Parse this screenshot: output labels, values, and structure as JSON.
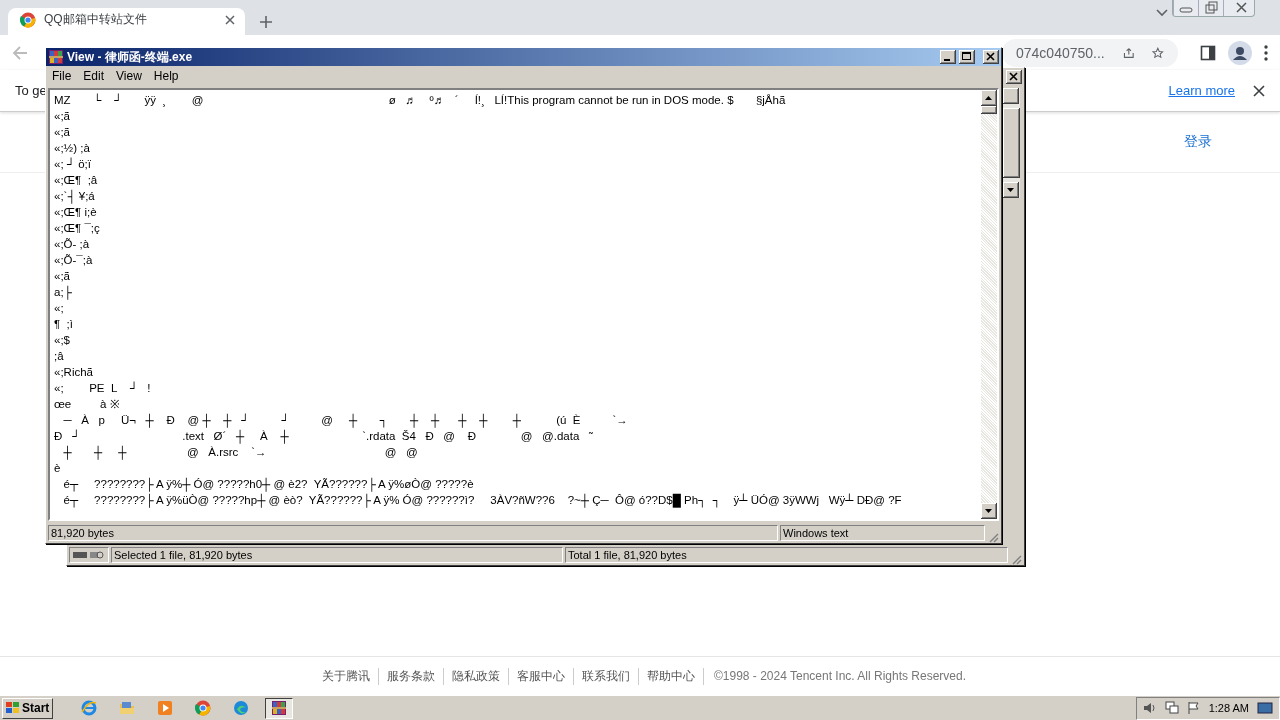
{
  "browser": {
    "tab": {
      "title": "QQ邮箱中转站文件"
    },
    "address": "074c040750...",
    "infobar": {
      "message": "To ge",
      "link": "Learn more"
    },
    "page": {
      "login": "登录",
      "footer_links": [
        "关于腾讯",
        "服务条款",
        "隐私政策",
        "客服中心",
        "联系我们",
        "帮助中心"
      ],
      "copyright": "©1998 - 2024 Tencent Inc. All Rights Reserved."
    }
  },
  "archiver_window": {
    "status_left": "Selected 1 file, 81,920 bytes",
    "status_right": "Total 1 file, 81,920 bytes"
  },
  "viewer_window": {
    "title": "View - 律师函-终端.exe",
    "menu": [
      "File",
      "Edit",
      "View",
      "Help"
    ],
    "lines": [
      "MZ       └    ┘       ÿÿ  ¸        @                                                          ø   ♬    º♬   ´     Í!¸   LÍ!This program cannot be run in DOS mode. $       §jÅhã",
      "«;ã",
      "«;ã",
      "«;½) ;à",
      "«; ┘ ö;ï",
      "«;Œ¶  ;â",
      "«;`┤ ¥;á",
      "«;Œ¶ i;è",
      "«;Œ¶ ¯;ç",
      "«;Õ- ;à",
      "«;Õ-¯;à",
      "«;ã",
      "a;├",
      "«;",
      "¶  ;ì",
      "«;$",
      ";â",
      "«;Richã",
      "«;        PE  L    ┘   !",
      "œe         à ※",
      "   ─   À   p     Ü¬   ┼    Ð    @ ┼    ┼   ┘          ┘          @     ┼       ┐       ┼    ┼      ┼    ┼        ┼           (ú  È          `→",
      "Ð   ┘                                .text   Ø´   ┼     À    ┼                       `.rdata  Š4   Ð   @    Ð              @   @.data   ˜",
      "   ┼       ┼     ┼                   @   À.rsrc    `→                                     @   @",
      "è",
      "   é┬     ????????├ A ÿ%┼ Ó@ ?????h0┼ @ è2?  YÃ??????├ A ÿ%øÒ@ ?????è",
      "   é┬     ????????├ A ÿ%üÒ@ ?????hp┼ @ èò?  YÃ??????├ A ÿ% Ó@ ??????ì?     3ÀV?ñW??6    ?~┼ Ç─  Ô@ ó??D$█ Ph┐  ┐    ÿ┴ ÜÓ@ 3ÿWWj   Wÿ┴ DÐ@ ?F"
    ],
    "status_size": "81,920 bytes",
    "status_encoding": "Windows text"
  },
  "taskbar": {
    "start": "Start",
    "clock": "1:28 AM",
    "apps": [
      {
        "kind": "ie",
        "selected": false
      },
      {
        "kind": "folder",
        "selected": false
      },
      {
        "kind": "media",
        "selected": false
      },
      {
        "kind": "chrome",
        "selected": false
      },
      {
        "kind": "edge",
        "selected": false
      },
      {
        "kind": "archiver",
        "selected": true
      }
    ]
  }
}
